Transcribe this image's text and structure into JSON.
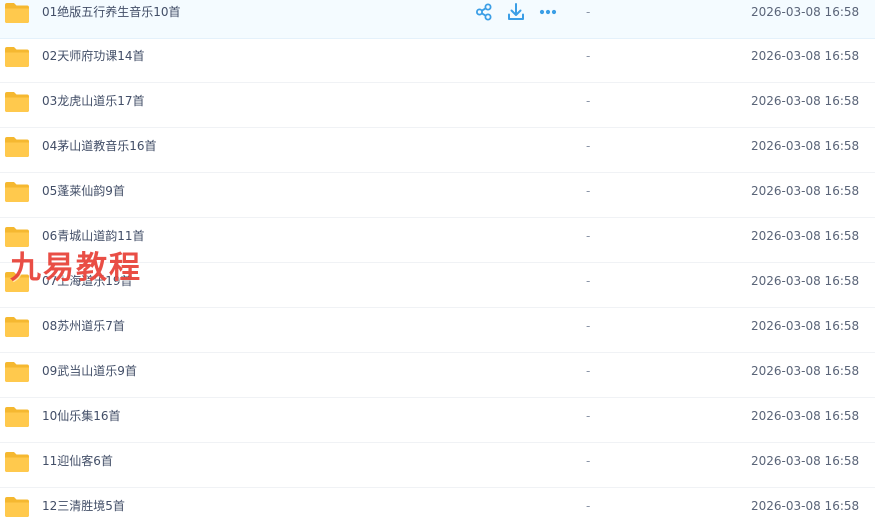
{
  "colors": {
    "folder": "#ffc94d",
    "folder_dark": "#f5b830",
    "action": "#3a9ee6",
    "watermark": "#e8453c"
  },
  "row_actions": {
    "share": "share-icon",
    "download": "download-icon",
    "more": "more-icon"
  },
  "watermark": "九易教程",
  "files": [
    {
      "name": "01绝版五行养生音乐10首",
      "size": "-",
      "time": "2026-03-08 16:58"
    },
    {
      "name": "02天师府功课14首",
      "size": "-",
      "time": "2026-03-08 16:58"
    },
    {
      "name": "03龙虎山道乐17首",
      "size": "-",
      "time": "2026-03-08 16:58"
    },
    {
      "name": "04茅山道教音乐16首",
      "size": "-",
      "time": "2026-03-08 16:58"
    },
    {
      "name": "05蓬莱仙韵9首",
      "size": "-",
      "time": "2026-03-08 16:58"
    },
    {
      "name": "06青城山道韵11首",
      "size": "-",
      "time": "2026-03-08 16:58"
    },
    {
      "name": "07上海道乐19首",
      "size": "-",
      "time": "2026-03-08 16:58"
    },
    {
      "name": "08苏州道乐7首",
      "size": "-",
      "time": "2026-03-08 16:58"
    },
    {
      "name": "09武当山道乐9首",
      "size": "-",
      "time": "2026-03-08 16:58"
    },
    {
      "name": "10仙乐集16首",
      "size": "-",
      "time": "2026-03-08 16:58"
    },
    {
      "name": "11迎仙客6首",
      "size": "-",
      "time": "2026-03-08 16:58"
    },
    {
      "name": "12三清胜境5首",
      "size": "-",
      "time": "2026-03-08 16:58"
    }
  ]
}
